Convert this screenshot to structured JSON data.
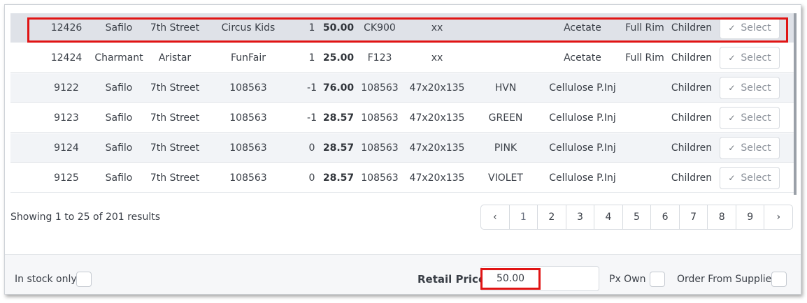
{
  "rows": [
    {
      "id": "12426",
      "supplier": "Safilo",
      "brand": "7th Street",
      "model": "Circus Kids",
      "qty": "1",
      "price": "50.00",
      "code": "CK900",
      "size": "xx",
      "colour": "",
      "material": "Acetate",
      "rim": "Full Rim",
      "age": "Children",
      "action": "Select"
    },
    {
      "id": "12424",
      "supplier": "Charmant",
      "brand": "Aristar",
      "model": "FunFair",
      "qty": "1",
      "price": "25.00",
      "code": "F123",
      "size": "xx",
      "colour": "",
      "material": "Acetate",
      "rim": "Full Rim",
      "age": "Children",
      "action": "Select"
    },
    {
      "id": "9122",
      "supplier": "Safilo",
      "brand": "7th Street",
      "model": "108563",
      "qty": "-1",
      "price": "76.00",
      "code": "108563",
      "size": "47x20x135",
      "colour": "HVN",
      "material": "Cellulose P.Inj",
      "rim": "",
      "age": "Children",
      "action": "Select"
    },
    {
      "id": "9123",
      "supplier": "Safilo",
      "brand": "7th Street",
      "model": "108563",
      "qty": "-1",
      "price": "28.57",
      "code": "108563",
      "size": "47x20x135",
      "colour": "GREEN",
      "material": "Cellulose P.Inj",
      "rim": "",
      "age": "Children",
      "action": "Select"
    },
    {
      "id": "9124",
      "supplier": "Safilo",
      "brand": "7th Street",
      "model": "108563",
      "qty": "0",
      "price": "28.57",
      "code": "108563",
      "size": "47x20x135",
      "colour": "PINK",
      "material": "Cellulose P.Inj",
      "rim": "",
      "age": "Children",
      "action": "Select"
    },
    {
      "id": "9125",
      "supplier": "Safilo",
      "brand": "7th Street",
      "model": "108563",
      "qty": "0",
      "price": "28.57",
      "code": "108563",
      "size": "47x20x135",
      "colour": "VIOLET",
      "material": "Cellulose P.Inj",
      "rim": "",
      "age": "Children",
      "action": "Select"
    }
  ],
  "results_text": "Showing 1 to 25 of 201 results",
  "pagination": {
    "prev": "‹",
    "pages": [
      "1",
      "2",
      "3",
      "4",
      "5",
      "6",
      "7",
      "8",
      "9"
    ],
    "next": "›",
    "active": "1"
  },
  "footer": {
    "in_stock_label": "In stock only",
    "retail_price_label": "Retail Price:",
    "retail_price_value": "50.00",
    "px_own_label": "Px Own",
    "order_supplier_label": "Order From Supplier"
  },
  "colors": {
    "highlight_box": "#e01414",
    "row_alt": "#f2f4f7",
    "row_selected": "#dfe2e8"
  },
  "icons": {
    "select": "check-icon",
    "prev": "chevron-left-icon",
    "next": "chevron-right-icon"
  }
}
